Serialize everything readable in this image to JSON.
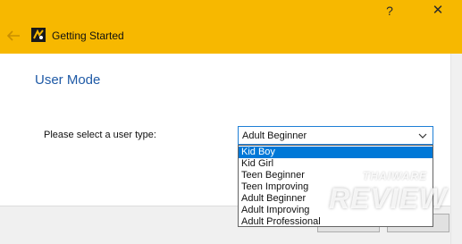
{
  "window": {
    "title": "Getting Started",
    "help_button": "?",
    "close_button": "✕",
    "accent_color": "#F7B800"
  },
  "page": {
    "heading": "User Mode",
    "prompt": "Please select a user type:"
  },
  "user_type_select": {
    "value": "Adult Beginner",
    "options": [
      "Kid Boy",
      "Kid Girl",
      "Teen Beginner",
      "Teen Improving",
      "Adult Beginner",
      "Adult Improving",
      "Adult Professional"
    ],
    "highlighted_option": "Kid Boy"
  },
  "watermark": {
    "top": "THAIWARE",
    "main": "REVIEW"
  },
  "icons": {
    "back": "arrow-left-icon",
    "app": "app-logo-icon",
    "dropdown": "chevron-down-icon"
  }
}
